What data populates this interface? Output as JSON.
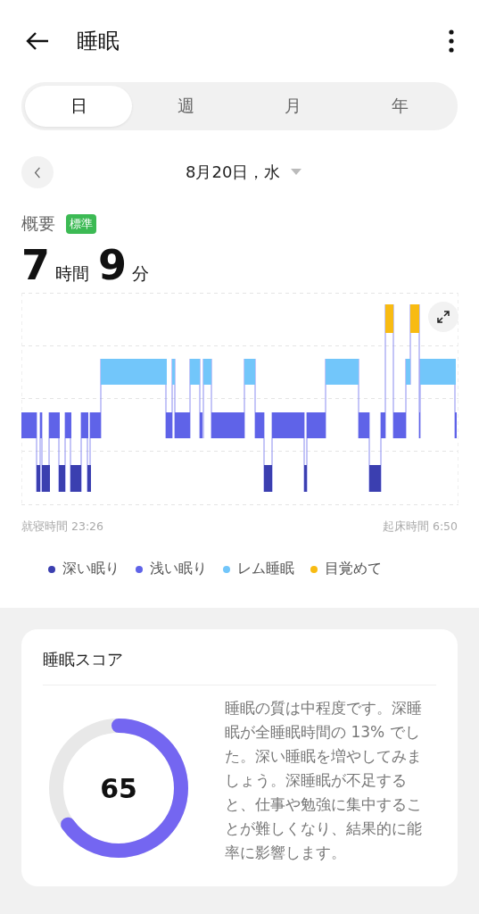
{
  "header": {
    "title": "睡眠"
  },
  "tabs": [
    {
      "label": "日",
      "selected": true
    },
    {
      "label": "週",
      "selected": false
    },
    {
      "label": "月",
      "selected": false
    },
    {
      "label": "年",
      "selected": false
    }
  ],
  "date": {
    "label": "8月20日，水"
  },
  "summary": {
    "label": "概要",
    "badge": "標準",
    "hours": "7",
    "hours_unit": "時間",
    "minutes": "9",
    "minutes_unit": "分"
  },
  "chart": {
    "bedtime": "就寝時間 23:26",
    "wake_time": "起床時間 6:50"
  },
  "legend": [
    {
      "label": "深い眠り",
      "color": "#3b3fb0"
    },
    {
      "label": "浅い眠り",
      "color": "#5f63e8"
    },
    {
      "label": "レム睡眠",
      "color": "#72c6fa"
    },
    {
      "label": "目覚めて",
      "color": "#f8bb12"
    }
  ],
  "score_card": {
    "title": "睡眠スコア",
    "score": "65",
    "level": 0.65,
    "description": "睡眠の質は中程度です。深睡眠が全睡眠時間の 13% でした。深い睡眠を増やしてみましょう。深睡眠が不足すると、仕事や勉強に集中することが難しくなり、結果的に能率に影響します。"
  }
}
